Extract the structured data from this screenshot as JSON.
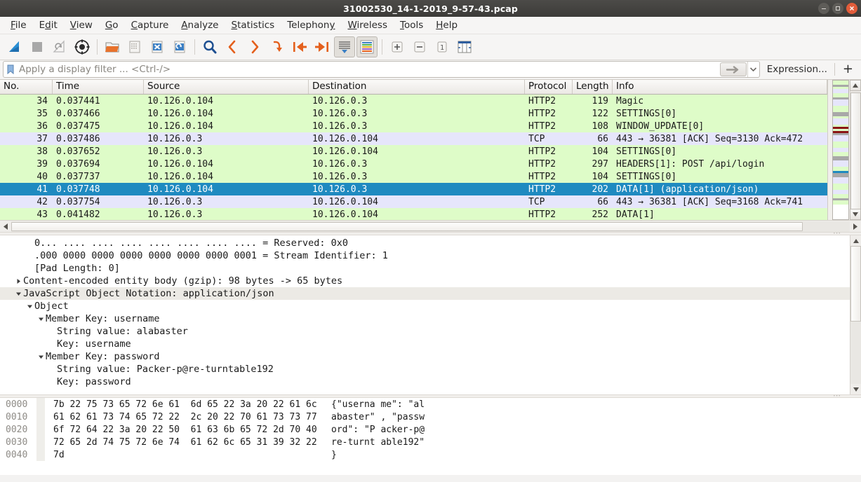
{
  "window": {
    "title": "31002530_14-1-2019_9-57-43.pcap",
    "controls": [
      {
        "name": "minimize",
        "glyph": "–"
      },
      {
        "name": "maximize",
        "glyph": "❐"
      },
      {
        "name": "close",
        "glyph": "✕"
      }
    ]
  },
  "menu": {
    "items": [
      {
        "label": "File",
        "mnemonic": "F"
      },
      {
        "label": "Edit",
        "mnemonic": "E"
      },
      {
        "label": "View",
        "mnemonic": "V"
      },
      {
        "label": "Go",
        "mnemonic": "G"
      },
      {
        "label": "Capture",
        "mnemonic": "C"
      },
      {
        "label": "Analyze",
        "mnemonic": "A"
      },
      {
        "label": "Statistics",
        "mnemonic": "S"
      },
      {
        "label": "Telephony",
        "mnemonic": "T"
      },
      {
        "label": "Wireless",
        "mnemonic": "W"
      },
      {
        "label": "Tools",
        "mnemonic": "T"
      },
      {
        "label": "Help",
        "mnemonic": "H"
      }
    ]
  },
  "toolbar": {
    "buttons": [
      {
        "name": "start-capture-icon",
        "title": "Start capturing packets"
      },
      {
        "name": "stop-capture-icon",
        "title": "Stop capturing packets"
      },
      {
        "name": "restart-capture-icon",
        "title": "Restart current capture"
      },
      {
        "name": "capture-options-icon",
        "title": "Capture options"
      },
      {
        "name": "open-file-icon",
        "title": "Open a capture file"
      },
      {
        "name": "save-file-icon",
        "title": "Save this capture file"
      },
      {
        "name": "close-file-icon",
        "title": "Close this capture file"
      },
      {
        "name": "reload-file-icon",
        "title": "Reload this file"
      },
      {
        "name": "find-packet-icon",
        "title": "Find a packet"
      },
      {
        "name": "go-back-icon",
        "title": "Go back in packet history"
      },
      {
        "name": "go-forward-icon",
        "title": "Go forward in packet history"
      },
      {
        "name": "go-to-packet-icon",
        "title": "Go to the packet"
      },
      {
        "name": "go-first-packet-icon",
        "title": "Go to the first packet"
      },
      {
        "name": "go-last-packet-icon",
        "title": "Go to the last packet"
      },
      {
        "name": "auto-scroll-icon",
        "title": "Auto scroll in live capture"
      },
      {
        "name": "colorize-icon",
        "title": "Colorize packet list"
      },
      {
        "name": "zoom-in-icon",
        "title": "Zoom in"
      },
      {
        "name": "zoom-out-icon",
        "title": "Zoom out"
      },
      {
        "name": "zoom-reset-icon",
        "title": "Normal size"
      },
      {
        "name": "resize-columns-icon",
        "title": "Resize columns"
      }
    ]
  },
  "filter": {
    "placeholder": "Apply a display filter ... <Ctrl-/>",
    "value": "",
    "bookmark_icon": "bookmark-icon",
    "apply_icon": "arrow-right-icon",
    "dropdown_icon": "chevron-down-icon",
    "expression_label": "Expression...",
    "plus_label": "+"
  },
  "packet_list": {
    "columns": [
      {
        "key": "no",
        "label": "No."
      },
      {
        "key": "time",
        "label": "Time"
      },
      {
        "key": "source",
        "label": "Source"
      },
      {
        "key": "destination",
        "label": "Destination"
      },
      {
        "key": "protocol",
        "label": "Protocol"
      },
      {
        "key": "length",
        "label": "Length"
      },
      {
        "key": "info",
        "label": "Info"
      }
    ],
    "rows": [
      {
        "no": "34",
        "time": "0.037441",
        "source": "10.126.0.104",
        "destination": "10.126.0.3",
        "protocol": "HTTP2",
        "length": "119",
        "info": "Magic",
        "style": "green"
      },
      {
        "no": "35",
        "time": "0.037466",
        "source": "10.126.0.104",
        "destination": "10.126.0.3",
        "protocol": "HTTP2",
        "length": "122",
        "info": "SETTINGS[0]",
        "style": "green"
      },
      {
        "no": "36",
        "time": "0.037475",
        "source": "10.126.0.104",
        "destination": "10.126.0.3",
        "protocol": "HTTP2",
        "length": "108",
        "info": "WINDOW_UPDATE[0]",
        "style": "green"
      },
      {
        "no": "37",
        "time": "0.037486",
        "source": "10.126.0.3",
        "destination": "10.126.0.104",
        "protocol": "TCP",
        "length": "66",
        "info": "443 → 36381 [ACK] Seq=3130 Ack=472",
        "style": "lav"
      },
      {
        "no": "38",
        "time": "0.037652",
        "source": "10.126.0.3",
        "destination": "10.126.0.104",
        "protocol": "HTTP2",
        "length": "104",
        "info": "SETTINGS[0]",
        "style": "green"
      },
      {
        "no": "39",
        "time": "0.037694",
        "source": "10.126.0.104",
        "destination": "10.126.0.3",
        "protocol": "HTTP2",
        "length": "297",
        "info": "HEADERS[1]: POST /api/login",
        "style": "green"
      },
      {
        "no": "40",
        "time": "0.037737",
        "source": "10.126.0.104",
        "destination": "10.126.0.3",
        "protocol": "HTTP2",
        "length": "104",
        "info": "SETTINGS[0]",
        "style": "green"
      },
      {
        "no": "41",
        "time": "0.037748",
        "source": "10.126.0.104",
        "destination": "10.126.0.3",
        "protocol": "HTTP2",
        "length": "202",
        "info": "DATA[1] (application/json)",
        "style": "sel"
      },
      {
        "no": "42",
        "time": "0.037754",
        "source": "10.126.0.3",
        "destination": "10.126.0.104",
        "protocol": "TCP",
        "length": "66",
        "info": "443 → 36381 [ACK] Seq=3168 Ack=741",
        "style": "lav"
      },
      {
        "no": "43",
        "time": "0.041482",
        "source": "10.126.0.3",
        "destination": "10.126.0.104",
        "protocol": "HTTP2",
        "length": "252",
        "info": "DATA[1]",
        "style": "green"
      }
    ]
  },
  "packet_detail": {
    "nodes": [
      {
        "indent": 2,
        "twisty": "",
        "text": "0... .... .... .... .... .... .... .... = Reserved: 0x0"
      },
      {
        "indent": 2,
        "twisty": "",
        "text": ".000 0000 0000 0000 0000 0000 0000 0001 = Stream Identifier: 1"
      },
      {
        "indent": 2,
        "twisty": "",
        "text": "[Pad Length: 0]"
      },
      {
        "indent": 1,
        "twisty": "collapsed",
        "text": "Content-encoded entity body (gzip): 98 bytes -> 65 bytes"
      },
      {
        "indent": 1,
        "twisty": "expanded",
        "text": "JavaScript Object Notation: application/json",
        "highlight": true
      },
      {
        "indent": 2,
        "twisty": "expanded",
        "text": "Object"
      },
      {
        "indent": 3,
        "twisty": "expanded",
        "text": "Member Key: username"
      },
      {
        "indent": 4,
        "twisty": "",
        "text": "String value: alabaster"
      },
      {
        "indent": 4,
        "twisty": "",
        "text": "Key: username"
      },
      {
        "indent": 3,
        "twisty": "expanded",
        "text": "Member Key: password"
      },
      {
        "indent": 4,
        "twisty": "",
        "text": "String value: Packer-p@re-turntable192"
      },
      {
        "indent": 4,
        "twisty": "",
        "text": "Key: password"
      }
    ]
  },
  "hex_dump": {
    "rows": [
      {
        "offset": "0000",
        "hex": "7b 22 75 73 65 72 6e 61  6d 65 22 3a 20 22 61 6c",
        "ascii": "{\"userna me\": \"al"
      },
      {
        "offset": "0010",
        "hex": "61 62 61 73 74 65 72 22  2c 20 22 70 61 73 73 77",
        "ascii": "abaster\" , \"passw"
      },
      {
        "offset": "0020",
        "hex": "6f 72 64 22 3a 20 22 50  61 63 6b 65 72 2d 70 40",
        "ascii": "ord\": \"P acker-p@"
      },
      {
        "offset": "0030",
        "hex": "72 65 2d 74 75 72 6e 74  61 62 6c 65 31 39 32 22",
        "ascii": "re-turnt able192\""
      },
      {
        "offset": "0040",
        "hex": "7d",
        "ascii": "}"
      }
    ]
  },
  "colors": {
    "row_green": "#defcc8",
    "row_lavender": "#e6e6fb",
    "row_selected": "#1f8ac0",
    "titlebar": "#3c3b38",
    "close_button": "#e25c3a",
    "chrome": "#f6f5f4"
  }
}
